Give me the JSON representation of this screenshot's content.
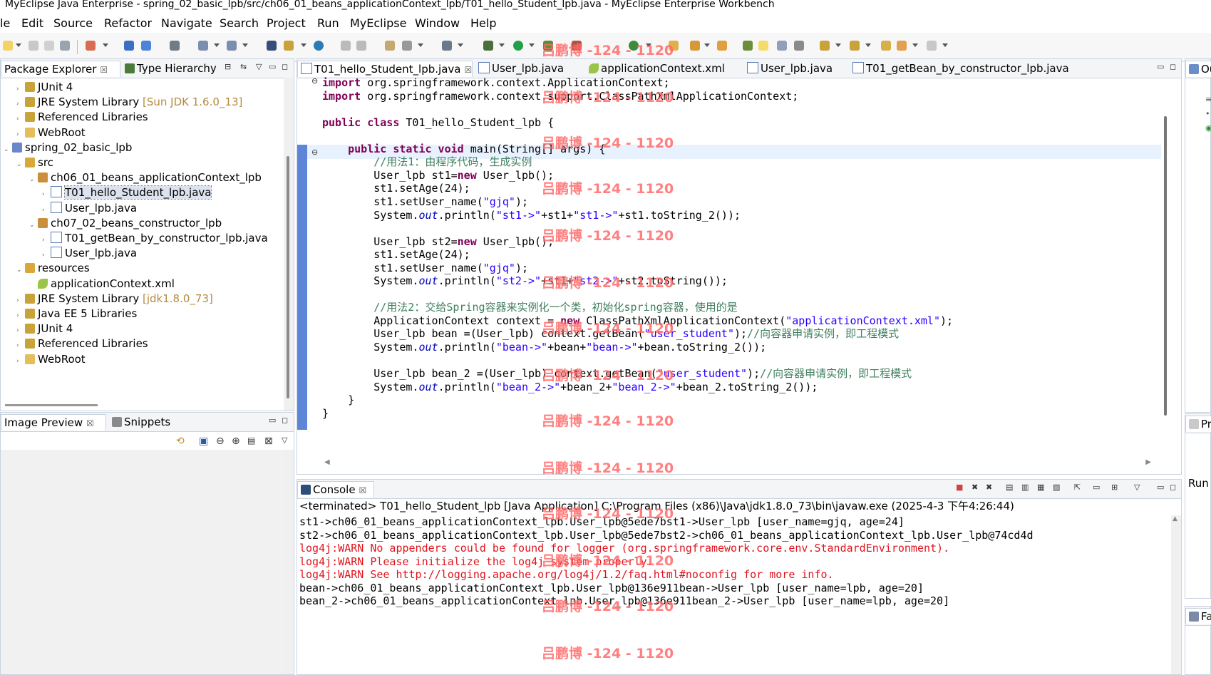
{
  "window": {
    "title": "MyEclipse Java Enterprise - spring_02_basic_lpb/src/ch06_01_beans_applicationContext_lpb/T01_hello_Student_lpb.java - MyEclipse Enterprise Workbench"
  },
  "menu": [
    "le",
    "Edit",
    "Source",
    "Refactor",
    "Navigate",
    "Search",
    "Project",
    "Run",
    "MyEclipse",
    "Window",
    "Help"
  ],
  "watermark": "吕鹏博 -124 - 1120",
  "left_views": {
    "tabs": [
      {
        "label": "Package Explorer"
      },
      {
        "label": "Type Hierarchy"
      }
    ],
    "tree": [
      {
        "label": "JUnit 4",
        "suffix": "",
        "icon": "library-icon",
        "indent": 2,
        "twisty": "›"
      },
      {
        "label": "JRE System Library ",
        "suffix": "[Sun JDK 1.6.0_13]",
        "icon": "library-icon",
        "indent": 2,
        "twisty": "›"
      },
      {
        "label": "Referenced Libraries",
        "suffix": "",
        "icon": "library-icon",
        "indent": 2,
        "twisty": "›"
      },
      {
        "label": "WebRoot",
        "suffix": "",
        "icon": "folder-icon",
        "indent": 2,
        "twisty": "›"
      },
      {
        "label": "spring_02_basic_lpb",
        "suffix": "",
        "icon": "project-icon",
        "indent": 1,
        "twisty": "⌄"
      },
      {
        "label": "src",
        "suffix": "",
        "icon": "source-folder-icon",
        "indent": 2,
        "twisty": "⌄"
      },
      {
        "label": "ch06_01_beans_applicationContext_lpb",
        "suffix": "",
        "icon": "package-icon",
        "indent": 3,
        "twisty": "⌄"
      },
      {
        "label": "T01_hello_Student_lpb.java",
        "suffix": "",
        "icon": "java-file-icon",
        "indent": 4,
        "twisty": "›",
        "selected": true
      },
      {
        "label": "User_lpb.java",
        "suffix": "",
        "icon": "java-file-icon",
        "indent": 4,
        "twisty": "›"
      },
      {
        "label": "ch07_02_beans_constructor_lpb",
        "suffix": "",
        "icon": "package-icon",
        "indent": 3,
        "twisty": "⌄"
      },
      {
        "label": "T01_getBean_by_constructor_lpb.java",
        "suffix": "",
        "icon": "java-file-icon",
        "indent": 4,
        "twisty": "›"
      },
      {
        "label": "User_lpb.java",
        "suffix": "",
        "icon": "java-file-icon",
        "indent": 4,
        "twisty": "›"
      },
      {
        "label": "resources",
        "suffix": "",
        "icon": "source-folder-icon",
        "indent": 2,
        "twisty": "⌄"
      },
      {
        "label": "applicationContext.xml",
        "suffix": "",
        "icon": "xml-file-icon",
        "indent": 3,
        "twisty": ""
      },
      {
        "label": "JRE System Library ",
        "suffix": "[jdk1.8.0_73]",
        "icon": "library-icon",
        "indent": 2,
        "twisty": "›"
      },
      {
        "label": "Java EE 5 Libraries",
        "suffix": "",
        "icon": "library-icon",
        "indent": 2,
        "twisty": "›"
      },
      {
        "label": "JUnit 4",
        "suffix": "",
        "icon": "library-icon",
        "indent": 2,
        "twisty": "›"
      },
      {
        "label": "Referenced Libraries",
        "suffix": "",
        "icon": "library-icon",
        "indent": 2,
        "twisty": "›"
      },
      {
        "label": "WebRoot",
        "suffix": "",
        "icon": "folder-icon",
        "indent": 2,
        "twisty": "›"
      }
    ]
  },
  "bottom_left_views": {
    "tabs": [
      {
        "label": "Image Preview"
      },
      {
        "label": "Snippets"
      }
    ]
  },
  "editor": {
    "tabs": [
      {
        "label": "T01_hello_Student_lpb.java",
        "active": true
      },
      {
        "label": "User_lpb.java"
      },
      {
        "label": "applicationContext.xml"
      },
      {
        "label": "User_lpb.java"
      },
      {
        "label": "T01_getBean_by_constructor_lpb.java"
      }
    ],
    "lines": [
      [
        [
          "kw",
          "import"
        ],
        [
          "",
          "org.springframework.context.ApplicationContext;"
        ]
      ],
      [
        [
          "kw",
          "import"
        ],
        [
          "",
          "org.springframework.context.support.ClassPathXmlApplicationContext;"
        ]
      ],
      [],
      [
        [
          "kw",
          "public class"
        ],
        [
          "",
          "T01_hello_Student_lpb {"
        ]
      ],
      [],
      [
        [
          "",
          "    "
        ],
        [
          "kw",
          "public static void"
        ],
        [
          "",
          "main(String[] args) {"
        ]
      ],
      [
        [
          "cm",
          "        //用法1：由程序代码，生成实例"
        ]
      ],
      [
        [
          "",
          "        User_lpb st1="
        ],
        [
          "kw",
          "new"
        ],
        [
          "",
          "User_lpb();"
        ]
      ],
      [
        [
          "",
          "        st1.setAge(24);"
        ]
      ],
      [
        [
          "",
          "        st1.setUser_name("
        ],
        [
          "str",
          "\"gjq\""
        ],
        [
          "",
          ");"
        ]
      ],
      [
        [
          "",
          "        System."
        ],
        [
          "it",
          "out"
        ],
        [
          "",
          ".println("
        ],
        [
          "str",
          "\"st1->\""
        ],
        [
          "",
          "+st1+"
        ],
        [
          "str",
          "\"st1->\""
        ],
        [
          "",
          "+st1.toString_2());"
        ]
      ],
      [],
      [
        [
          "",
          "        User_lpb st2="
        ],
        [
          "kw",
          "new"
        ],
        [
          "",
          "User_lpb();"
        ]
      ],
      [
        [
          "",
          "        st1.setAge(24);"
        ]
      ],
      [
        [
          "",
          "        st1.setUser_name("
        ],
        [
          "str",
          "\"gjq\""
        ],
        [
          "",
          ");"
        ]
      ],
      [
        [
          "",
          "        System."
        ],
        [
          "it",
          "out"
        ],
        [
          "",
          ".println("
        ],
        [
          "str",
          "\"st2->\""
        ],
        [
          "",
          "+st1+"
        ],
        [
          "str",
          "\"st2->\""
        ],
        [
          "",
          "+st2.toString());"
        ]
      ],
      [],
      [
        [
          "cm",
          "        //用法2：交给Spring容器来实例化一个类，初始化spring容器，使用的是"
        ]
      ],
      [
        [
          "",
          "        ApplicationContext context = "
        ],
        [
          "kw",
          "new"
        ],
        [
          "",
          "ClassPathXmlApplicationContext("
        ],
        [
          "str",
          "\"applicationContext.xml\""
        ],
        [
          "",
          ");"
        ]
      ],
      [
        [
          "",
          "        User_lpb bean =(User_lpb) context.getBean("
        ],
        [
          "str",
          "\"user_student\""
        ],
        [
          "",
          ");"
        ],
        [
          "cm",
          "//向容器申请实例，即工程模式"
        ]
      ],
      [
        [
          "",
          "        System."
        ],
        [
          "it",
          "out"
        ],
        [
          "",
          ".println("
        ],
        [
          "str",
          "\"bean->\""
        ],
        [
          "",
          "+bean+"
        ],
        [
          "str",
          "\"bean->\""
        ],
        [
          "",
          "+bean.toString_2());"
        ]
      ],
      [],
      [
        [
          "",
          "        User_lpb bean_2 =(User_lpb) context.getBean("
        ],
        [
          "str",
          "\"user_student\""
        ],
        [
          "",
          ");"
        ],
        [
          "cm",
          "//向容器申请实例，即工程模式"
        ]
      ],
      [
        [
          "",
          "        System."
        ],
        [
          "it",
          "out"
        ],
        [
          "",
          ".println("
        ],
        [
          "str",
          "\"bean_2->\""
        ],
        [
          "",
          "+bean_2+"
        ],
        [
          "str",
          "\"bean_2->\""
        ],
        [
          "",
          "+bean_2.toString_2());"
        ]
      ],
      [
        [
          "",
          "    }"
        ]
      ],
      [
        [
          "",
          "}"
        ]
      ]
    ]
  },
  "console": {
    "tab": "Console",
    "header": "<terminated> T01_hello_Student_lpb [Java Application] C:\\Program Files (x86)\\Java\\jdk1.8.0_73\\bin\\javaw.exe (2025-4-3 下午4:26:44)",
    "lines": [
      {
        "text": "st1->ch06_01_beans_applicationContext_lpb.User_lpb@5ede7bst1->User_lpb [user_name=gjq, age=24]",
        "err": false
      },
      {
        "text": "st2->ch06_01_beans_applicationContext_lpb.User_lpb@5ede7bst2->ch06_01_beans_applicationContext_lpb.User_lpb@74cd4d",
        "err": false
      },
      {
        "text": "log4j:WARN No appenders could be found for logger (org.springframework.core.env.StandardEnvironment).",
        "err": true
      },
      {
        "text": "log4j:WARN Please initialize the log4j system properly.",
        "err": true
      },
      {
        "text": "log4j:WARN See http://logging.apache.org/log4j/1.2/faq.html#noconfig for more info.",
        "err": true
      },
      {
        "text": "bean->ch06_01_beans_applicationContext_lpb.User_lpb@136e911bean->User_lpb [user_name=lpb, age=20]",
        "err": false
      },
      {
        "text": "bean_2->ch06_01_beans_applicationContext_lpb.User_lpb@136e911bean_2->User_lpb [user_name=lpb, age=20]",
        "err": false
      }
    ]
  },
  "right_views": {
    "outline_label": "Ou",
    "properties_label": "Pr",
    "run_label": "Run",
    "bottom_label": "Fa"
  }
}
